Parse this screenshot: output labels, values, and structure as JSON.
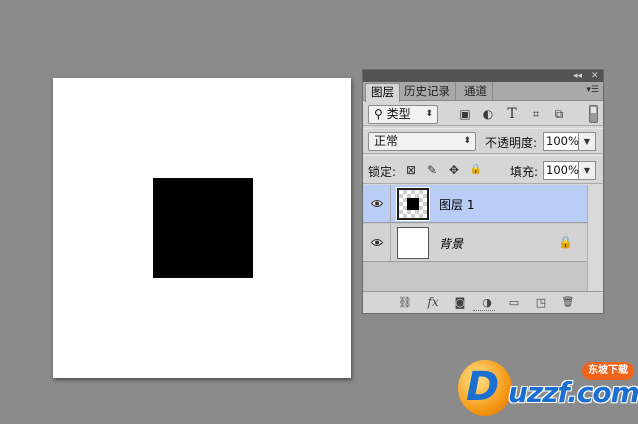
{
  "canvas": {
    "background": "#ffffff",
    "shape_color": "#000000"
  },
  "panel": {
    "tabs": [
      {
        "label": "图层",
        "active": true
      },
      {
        "label": "历史记录",
        "active": false
      },
      {
        "label": "通道",
        "active": false
      }
    ],
    "topbar": {
      "collapse": "◂◂",
      "close": "✕"
    },
    "menu_icon": "menu-icon",
    "filter": {
      "kind_label": "类型",
      "search_glyph": "⚲",
      "arrow": "⬍",
      "icons": [
        "image-filter-icon",
        "adjustment-filter-icon",
        "type-filter-icon",
        "shape-filter-icon",
        "smart-object-filter-icon"
      ],
      "glyphs": [
        "▣",
        "◐",
        "T",
        "⌗",
        "⧉"
      ]
    },
    "blend": {
      "mode": "正常",
      "arrow": "⬍",
      "opacity_label": "不透明度:",
      "opacity_value": "100%",
      "dropdown_arrow": "▼"
    },
    "lock": {
      "label": "锁定:",
      "glyphs": [
        "⊠",
        "✎",
        "✥",
        "🔒"
      ],
      "fill_label": "填充:",
      "fill_value": "100%",
      "dropdown_arrow": "▼"
    },
    "layers": [
      {
        "name": "图层 1",
        "selected": true,
        "visible": true,
        "locked": false
      },
      {
        "name": "背景",
        "selected": false,
        "visible": true,
        "locked": true,
        "lock_glyph": "🔒"
      }
    ],
    "bottom_icons": {
      "link": "⛓",
      "fx": "fx",
      "mask": "◙",
      "adjust": "◑",
      "group": "▭",
      "new": "◳",
      "trash": "🗑"
    },
    "colors": {
      "selected_row": "#b9cdf5",
      "panel_bg": "#d6d6d6"
    }
  },
  "watermark": {
    "letter": "D",
    "text": "uzzf.com",
    "tag": "东坡下载"
  }
}
